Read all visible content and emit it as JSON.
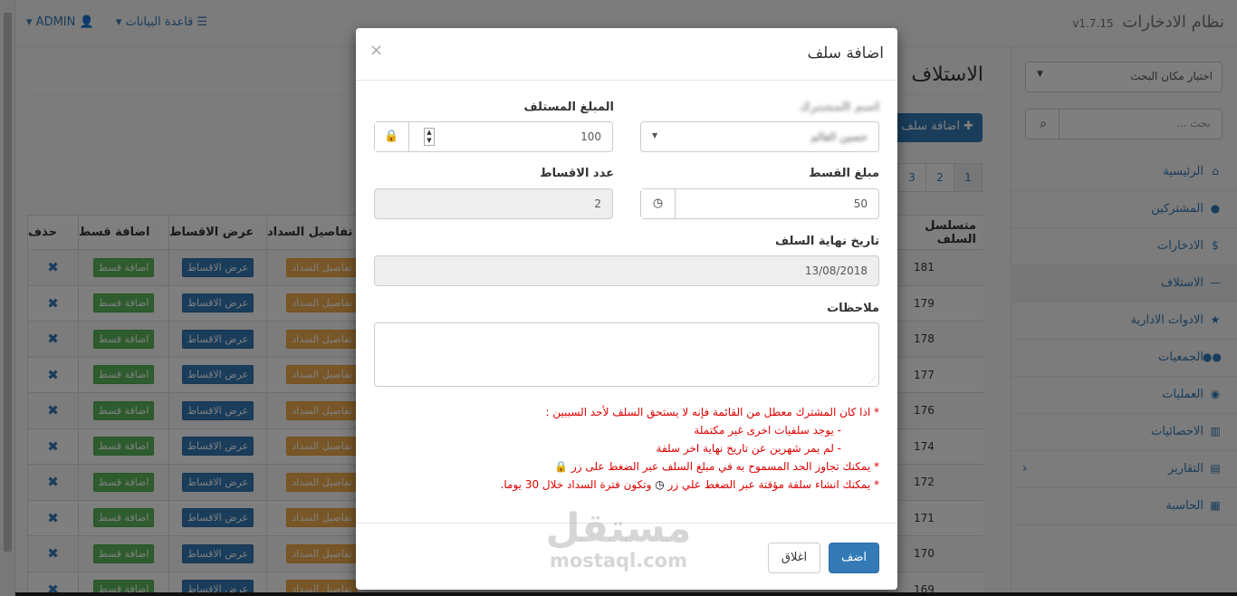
{
  "navbar": {
    "brand": "نظام الادخارات",
    "version": "v1.7.15",
    "database_menu": "قاعدة البيانات",
    "user_menu": "ADMIN"
  },
  "sidebar": {
    "location_select": "اختيار مكان البحث",
    "search_placeholder": "بحث ...",
    "items": [
      {
        "label": "الرئيسية",
        "icon": "home-icon"
      },
      {
        "label": "المشتركين",
        "icon": "user-icon"
      },
      {
        "label": "الادخارات",
        "icon": "dollar-icon"
      },
      {
        "label": "الاستلاف",
        "icon": "minus-icon"
      },
      {
        "label": "الادوات الادارية",
        "icon": "star-icon"
      },
      {
        "label": "الجمعيات",
        "icon": "users-icon"
      },
      {
        "label": "العمليات",
        "icon": "eye-icon"
      },
      {
        "label": "الاحصائيات",
        "icon": "bar-chart-icon"
      },
      {
        "label": "التقارير",
        "icon": "report-icon"
      },
      {
        "label": "الحاسبة",
        "icon": "calculator-icon"
      }
    ]
  },
  "page": {
    "title": "الاستلاف",
    "add_button": "اضافة سلف",
    "pages": [
      "1",
      "2",
      "3"
    ]
  },
  "table": {
    "headers": {
      "delete": "حذف",
      "add_installment": "اضافة قسط",
      "view_installments": "عرض الاقساط",
      "payment_details": "تفاصيل السداد",
      "serial": "متسلسل السلف"
    },
    "row_labels": {
      "add_installment": "اضافة قسط",
      "view_installments": "عرض الاقساط",
      "payment_details": "تفاصيل السداد",
      "delete": "✖"
    },
    "serials": [
      "181",
      "179",
      "178",
      "177",
      "176",
      "174",
      "172",
      "171",
      "170",
      "169"
    ]
  },
  "modal": {
    "title": "اضافة سلف",
    "close": "×",
    "subscriber_name_label": "اسم المشترك",
    "subscriber_name_value": "حسين العالم",
    "loan_amount_label": "المبلغ المستلف",
    "loan_amount_value": "100",
    "installment_amount_label": "مبلغ القسط",
    "installment_amount_value": "50",
    "installments_count_label": "عدد الاقساط",
    "installments_count_value": "2",
    "end_date_label": "تاريخ نهاية السلف",
    "end_date_value": "13/08/2018",
    "notes_label": "ملاحظات",
    "notes_value": "",
    "warnings": [
      "* اذا كان المشترك معطل من القائمة فإنه لا يستحق السلف لأحد السببين :",
      "- يوجد سلفيات اخرى غير مكتملة",
      "- لم يمر شهرين عن تاريخ نهاية اخر سلفة",
      "* يمكنك تجاوز الحد المسموح به في مبلغ السلف عبر الضغط على زر",
      "* يمكنك انشاء سلفة مؤقتة عبر الضغط علي زر",
      "وتكون فترة السداد خلال 30 يوما."
    ],
    "submit": "اضف",
    "cancel": "اغلاق"
  },
  "watermark": {
    "arabic": "مستقل",
    "latin": "mostaql.com"
  }
}
